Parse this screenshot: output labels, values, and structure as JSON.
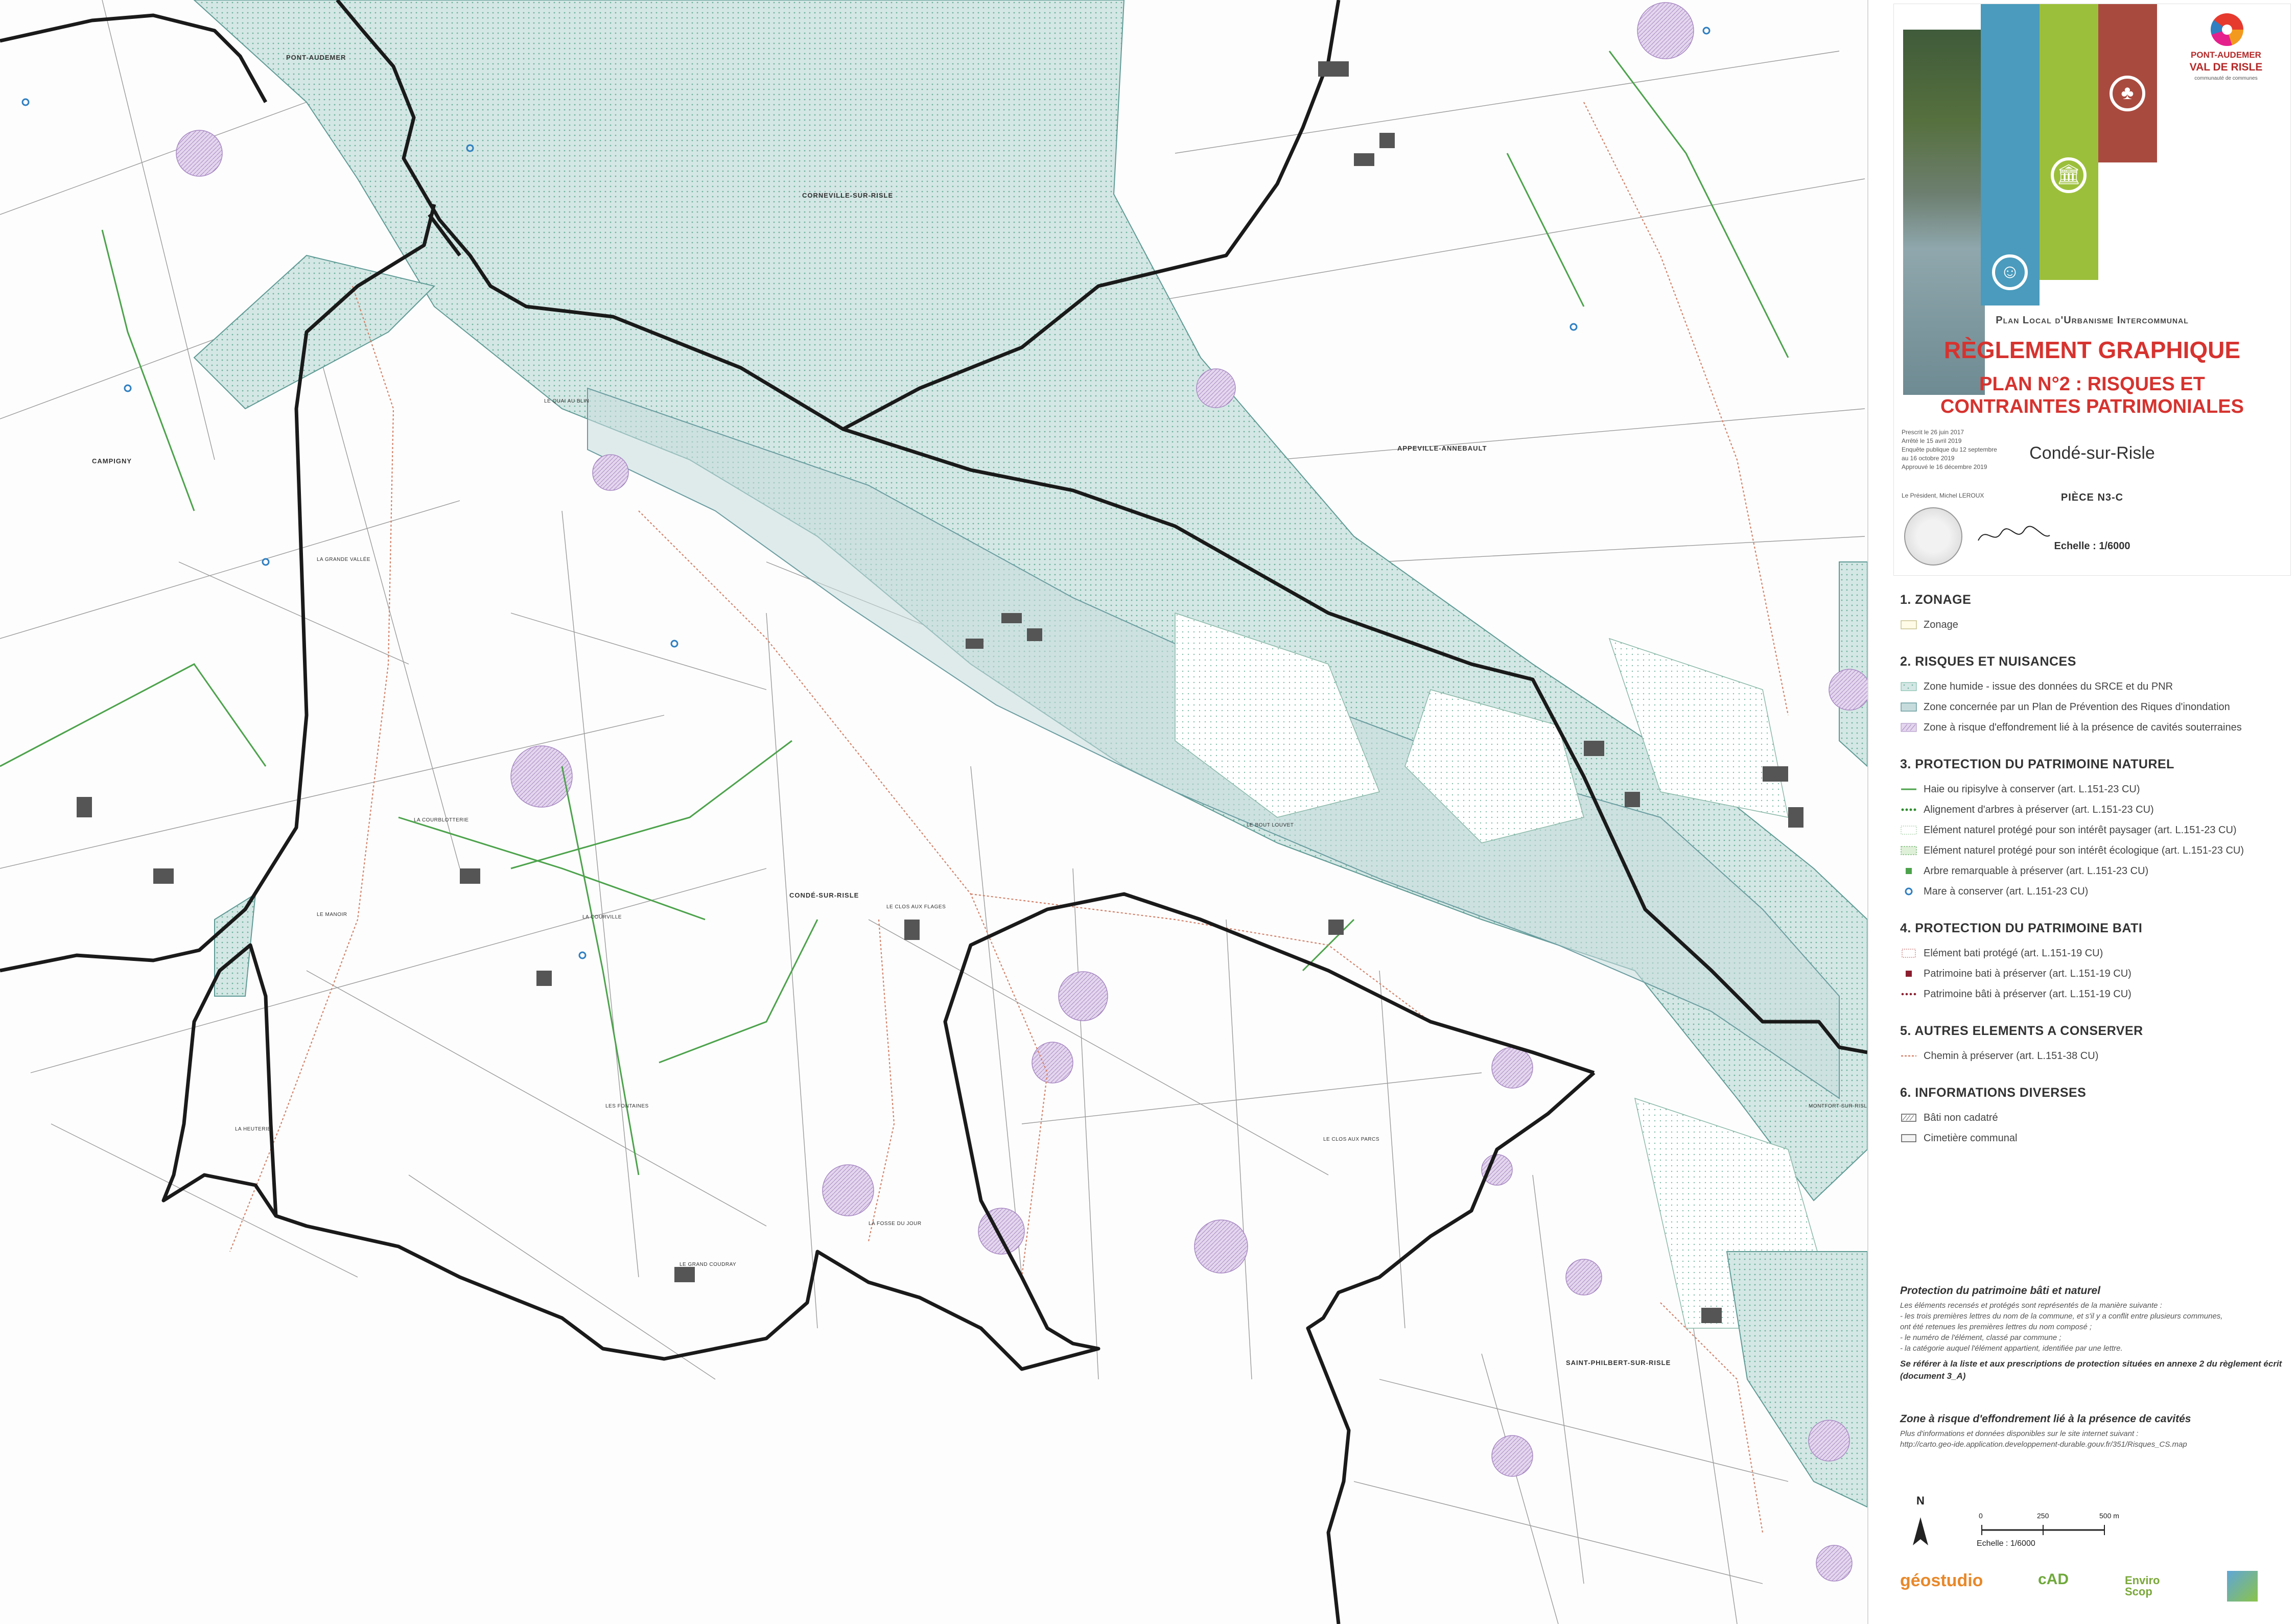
{
  "map": {
    "places": [
      {
        "name": "PONT-AUDEMER"
      },
      {
        "name": "CORNEVILLE-SUR-RISLE"
      },
      {
        "name": "CAMPIGNY"
      },
      {
        "name": "LE QUAI AU BLIN"
      },
      {
        "name": "LA GRANDE VALLÉE"
      },
      {
        "name": "APPEVILLE-ANNEBAULT"
      },
      {
        "name": "CONDÉ-SUR-RISLE"
      },
      {
        "name": "LA COURBLOTTERIE"
      },
      {
        "name": "LA COURVILLE"
      },
      {
        "name": "LA HEUTERIE"
      },
      {
        "name": "LE MANOIR"
      },
      {
        "name": "LES FONTAINES"
      },
      {
        "name": "LE GRAND COUDRAY"
      },
      {
        "name": "LA FOSSE DU JOUR"
      },
      {
        "name": "LE BOUT LOUVET"
      },
      {
        "name": "LE CLOS AUX FLAGES"
      },
      {
        "name": "LE CLOS AUX PARCS"
      },
      {
        "name": "SAINT-PHILBERT-SUR-RISLE"
      },
      {
        "name": "MONTFORT-SUR-RISLE"
      }
    ]
  },
  "cover": {
    "plu": "Plan Local d'Urbanisme Intercommunal",
    "title": "RÈGLEMENT GRAPHIQUE",
    "subtitle1": "PLAN N°2 : RISQUES ET",
    "subtitle2": "CONTRAINTES PATRIMONIALES",
    "commune": "Condé-sur-Risle",
    "piece": "PIÈCE N3-C",
    "echelle": "Echelle : 1/6000",
    "logo_line1": "PONT-AUDEMER",
    "logo_line2": "VAL DE RISLE",
    "logo_line3": "communauté de communes",
    "dates": [
      "Prescrit le 26 juin 2017",
      "Arrêté le 15 avril 2019",
      "Enquête publique du 12 septembre",
      "au 16 octobre 2019",
      "Approuvé le 16 décembre 2019"
    ],
    "president": "Le Président, Michel LEROUX"
  },
  "legend": {
    "sections": [
      {
        "title": "1. ZONAGE",
        "items": [
          {
            "label": "Zonage",
            "sym": "zonage"
          }
        ]
      },
      {
        "title": "2. RISQUES ET NUISANCES",
        "items": [
          {
            "label": "Zone humide - issue des données du SRCE et du PNR",
            "sym": "humide"
          },
          {
            "label": "Zone concernée par un Plan de Prévention des Riques d'inondation",
            "sym": "ppri"
          },
          {
            "label": "Zone à risque d'effondrement lié à la présence de cavités souterraines",
            "sym": "cavite"
          }
        ]
      },
      {
        "title": "3. PROTECTION DU PATRIMOINE NATUREL",
        "items": [
          {
            "label": "Haie ou ripisylve à conserver (art. L.151-23 CU)",
            "sym": "haie"
          },
          {
            "label": "Alignement d'arbres à préserver (art. L.151-23 CU)",
            "sym": "alignement"
          },
          {
            "label": "Elément naturel protégé pour son intérêt paysager (art. L.151-23 CU)",
            "sym": "paysager"
          },
          {
            "label": "Elément naturel protégé pour son intérêt écologique (art. L.151-23 CU)",
            "sym": "ecologique"
          },
          {
            "label": "Arbre remarquable à préserver (art. L.151-23 CU)",
            "sym": "arbre"
          },
          {
            "label": "Mare à conserver (art. L.151-23 CU)",
            "sym": "mare"
          }
        ]
      },
      {
        "title": "4. PROTECTION DU PATRIMOINE BATI",
        "items": [
          {
            "label": "Elément bati protégé (art. L.151-19 CU)",
            "sym": "bati-protege"
          },
          {
            "label": "Patrimoine bati à préserver (art. L.151-19 CU)",
            "sym": "bati-point"
          },
          {
            "label": "Patrimoine bâti à préserver (art. L.151-19 CU)",
            "sym": "bati-ligne"
          }
        ]
      },
      {
        "title": "5. AUTRES ELEMENTS A CONSERVER",
        "items": [
          {
            "label": "Chemin à préserver  (art. L.151-38 CU)",
            "sym": "chemin"
          }
        ]
      },
      {
        "title": "6. INFORMATIONS DIVERSES",
        "items": [
          {
            "label": "Bâti non cadatré",
            "sym": "nonbati"
          },
          {
            "label": "Cimetière communal",
            "sym": "cimetiere"
          }
        ]
      }
    ]
  },
  "notes": {
    "title1": "Protection du patrimoine bâti et naturel",
    "lines1": [
      "Les éléments recensés et protégés sont représentés de la manière suivante :",
      "- les trois premières lettres du nom de la commune, et s'il y a conflit entre plusieurs communes,",
      "ont été retenues les premières lettres du nom composé ;",
      "- le numéro de l'élément, classé par commune ;",
      "- la catégorie auquel l'élément appartient, identifiée par une lettre."
    ],
    "strong1": "Se référer à la liste et aux prescriptions de protection situées en annexe 2 du règlement écrit (document 3_A)",
    "title2": "Zone à risque d'effondrement lié à la présence de cavités",
    "lines2": [
      "Plus d'informations et données disponibles sur le site internet suivant :",
      "http://carto.geo-ide.application.developpement-durable.gouv.fr/351/Risques_CS.map"
    ]
  },
  "scale": {
    "north": "N",
    "t0": "0",
    "t1": "250",
    "t2": "500 m",
    "label": "Echelle : 1/6000"
  },
  "footer": {
    "geostudio": "géostudio",
    "cad": "cAD",
    "enviro1": "Enviro",
    "enviro2": "Scop"
  },
  "colors": {
    "wetland": "#bcd8d6",
    "hatch": "#6fb39f",
    "border": "#1f3a33",
    "cavity": "#c9b3d9",
    "path": "#d4826a",
    "hedge": "#4ca24b",
    "pond": "#2f7fc1",
    "red": "#d6332f"
  }
}
